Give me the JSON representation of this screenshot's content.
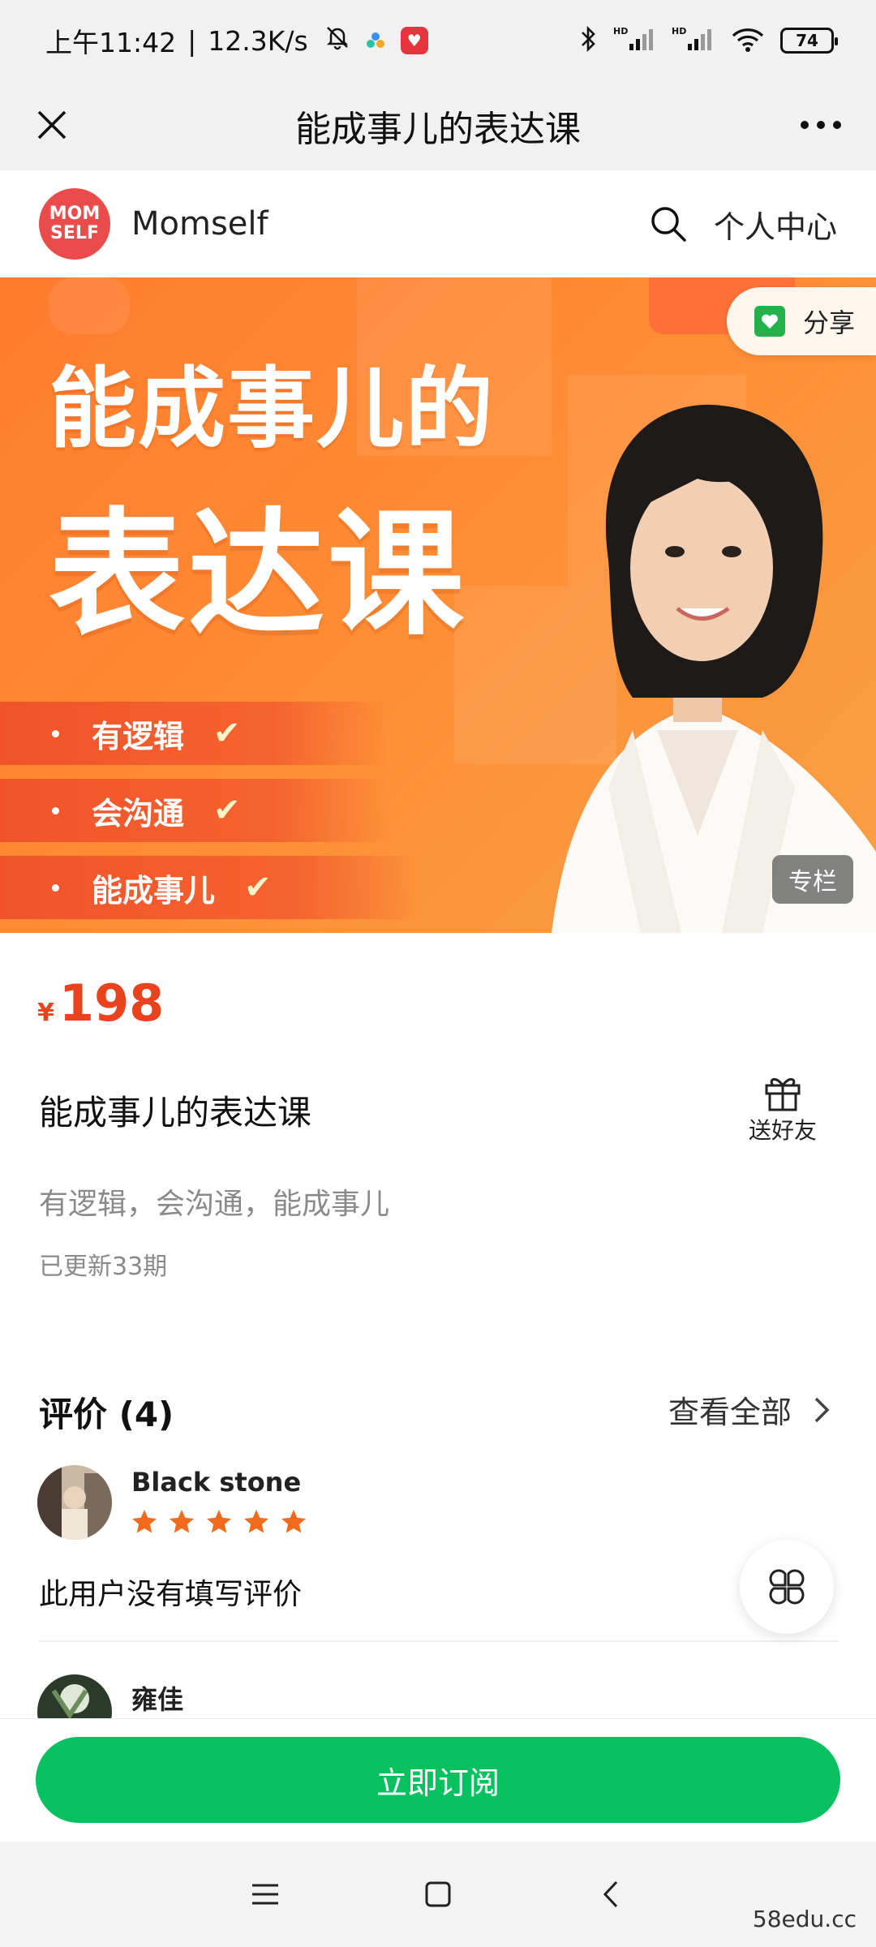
{
  "status": {
    "time": "上午11:42",
    "speed": "12.3K/s",
    "battery": "74",
    "signal_label_1": "HD",
    "signal_label_2": "HD"
  },
  "titlebar": {
    "title": "能成事儿的表达课"
  },
  "brand": {
    "logo_line1": "MOM",
    "logo_line2": "SELF",
    "name": "Momself",
    "profile_link": "个人中心"
  },
  "banner": {
    "title_line1": "能成事儿的",
    "title_line2": "表达课",
    "bullets": [
      "有逻辑",
      "会沟通",
      "能成事儿"
    ],
    "share_label": "分享",
    "tag": "专栏"
  },
  "product": {
    "currency": "¥",
    "price": "198",
    "title": "能成事儿的表达课",
    "gift_label": "送好友",
    "subtitle": "有逻辑，会沟通，能成事儿",
    "updated": "已更新33期"
  },
  "reviews": {
    "heading": "评价 (4)",
    "view_all": "查看全部",
    "items": [
      {
        "name": "Black stone",
        "rating": 5,
        "text": "此用户没有填写评价"
      },
      {
        "name": "雍佳"
      }
    ]
  },
  "actions": {
    "subscribe": "立即订阅"
  },
  "watermark": "58edu.cc",
  "colors": {
    "accent_green": "#07c160",
    "price_red": "#e8421f",
    "banner_orange": "#ff8c34",
    "star_orange": "#f26b1d"
  }
}
